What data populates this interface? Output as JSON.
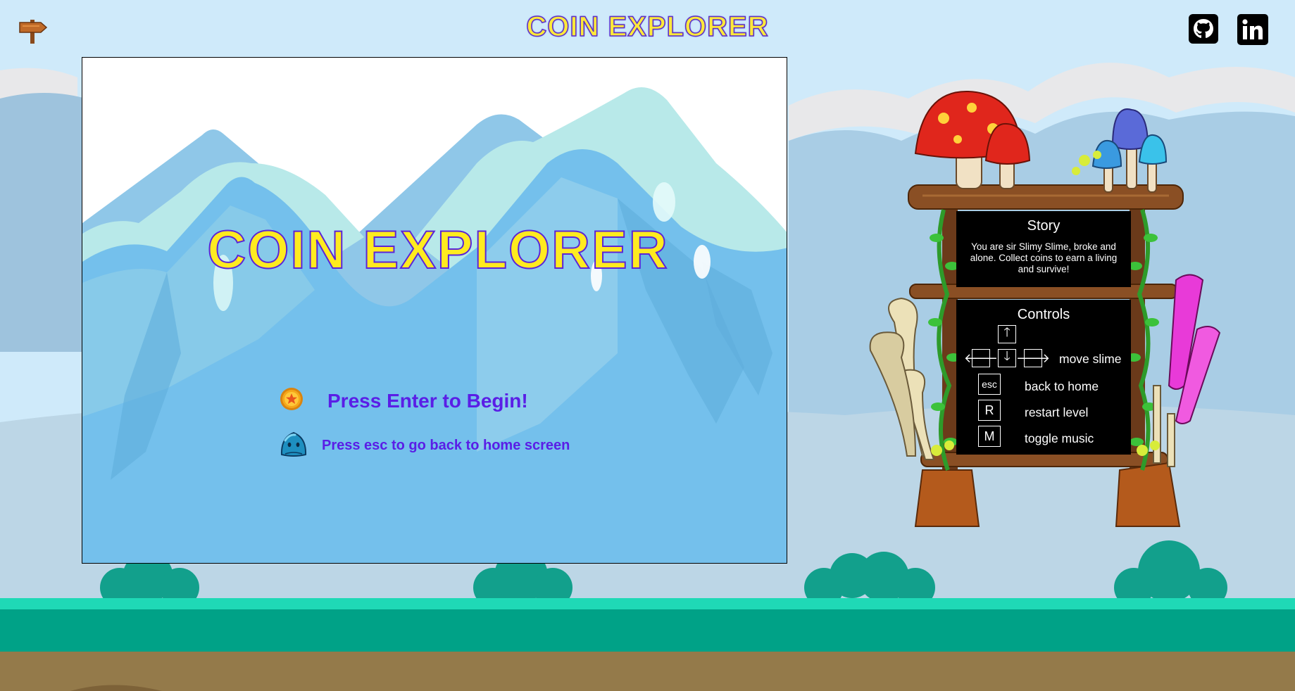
{
  "header": {
    "title": "COIN EXPLORER",
    "back_icon": "signpost-arrow-icon",
    "github_icon": "github-icon",
    "linkedin_icon": "linkedin-icon"
  },
  "game": {
    "title": "COIN EXPLORER",
    "enter_prompt": "Press Enter to Begin!",
    "esc_prompt": "Press esc to go back to home screen",
    "coin_icon": "coin-icon",
    "slime_icon": "slime-icon"
  },
  "story": {
    "title": "Story",
    "text": "You are sir Slimy Slime, broke and alone. Collect coins to earn a living and survive!"
  },
  "controls": {
    "title": "Controls",
    "arrow_up": "🡑",
    "arrow_left": "🡐",
    "arrow_down": "🡓",
    "arrow_right": "🡒",
    "move_label": "move slime",
    "esc_key": "esc",
    "esc_label": "back to home",
    "r_key": "R",
    "r_label": "restart level",
    "m_key": "M",
    "m_label": "toggle music"
  },
  "colors": {
    "sky": "#cfeafa",
    "title_fill": "#ffeb1f",
    "title_outline": "#5b24d8",
    "prompt_text": "#5a1ee6",
    "grass": "#00a287",
    "dirt": "#947a4a"
  }
}
